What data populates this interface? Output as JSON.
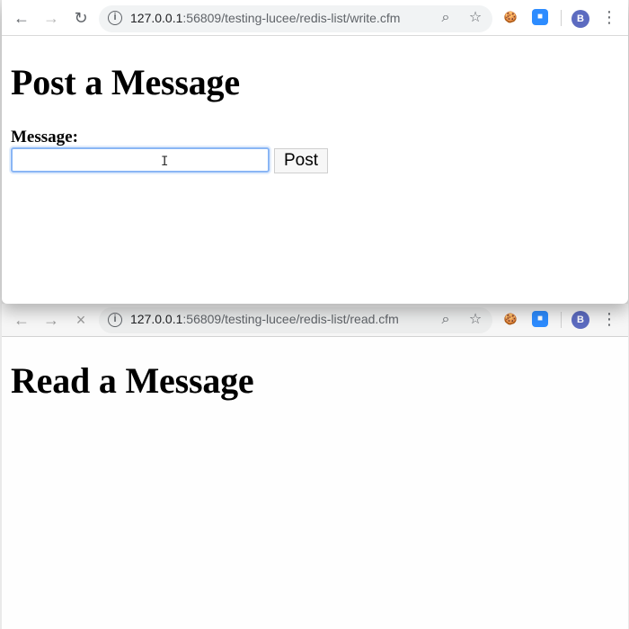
{
  "windows": [
    {
      "url": {
        "host": "127.0.0.1",
        "path": ":56809/testing-lucee/redis-list/write.cfm"
      },
      "toolbar": {
        "avatar": "B"
      },
      "page": {
        "title": "Post a Message",
        "message_label": "Message:",
        "input_value": "",
        "button_label": "Post"
      }
    },
    {
      "url": {
        "host": "127.0.0.1",
        "path": ":56809/testing-lucee/redis-list/read.cfm"
      },
      "toolbar": {
        "avatar": "B"
      },
      "page": {
        "title": "Read a Message"
      }
    }
  ],
  "icons": {
    "back": "←",
    "forward": "→",
    "reload": "↻",
    "stop": "×",
    "info": "i",
    "zoom": "⌕",
    "star": "☆",
    "cookie": "🍪",
    "video": "■",
    "menu": "⋮",
    "text_cursor": "I"
  }
}
